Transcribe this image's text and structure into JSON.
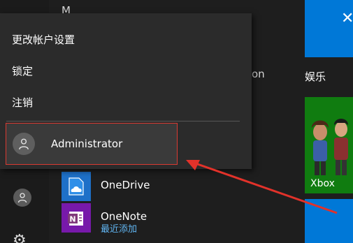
{
  "rail": {
    "user_icon": "user-icon",
    "settings_icon": "gear-icon"
  },
  "app_list": {
    "letter_header": "M",
    "partial_item_text": "on",
    "apps": [
      {
        "name": "OneDrive",
        "icon": "onedrive-icon",
        "sub": ""
      },
      {
        "name": "OneNote",
        "icon": "onenote-icon",
        "sub": "最近添加"
      }
    ]
  },
  "tiles": {
    "group_label": "娱乐",
    "xbox_label": "Xbox"
  },
  "account_menu": {
    "items": [
      "更改帐户设置",
      "锁定",
      "注销"
    ],
    "user_name": "Administrator"
  },
  "colors": {
    "start_background": "#1e1e1e",
    "menu_background": "#2b2b2b",
    "tile_blue": "#0078d7",
    "tile_green": "#107c10",
    "annotation_red": "#d93a32",
    "subtext_blue": "#61b6f3"
  }
}
